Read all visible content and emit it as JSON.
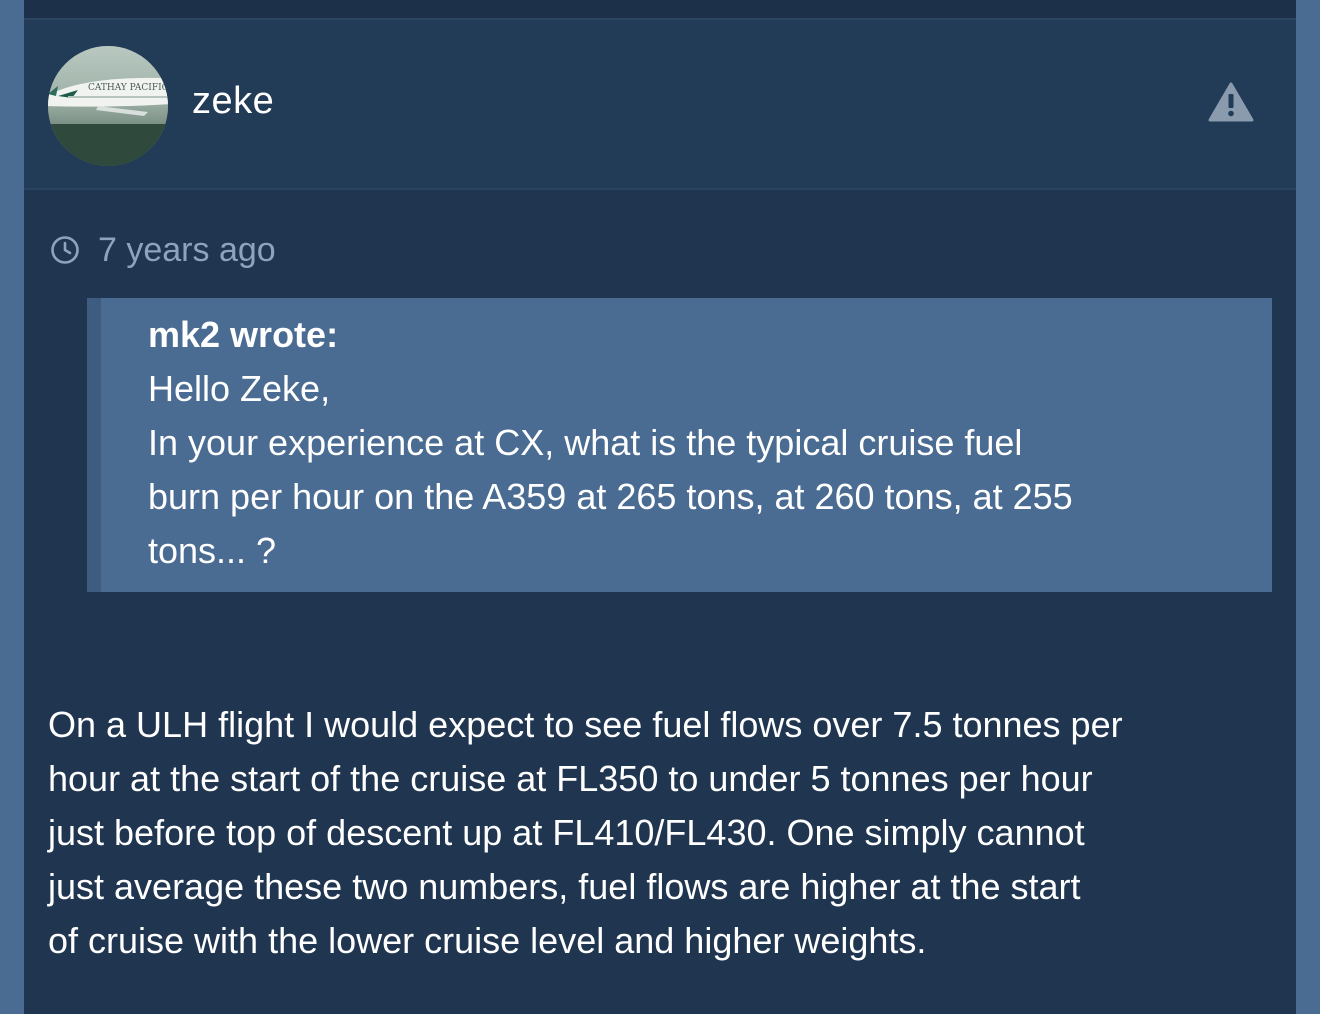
{
  "post": {
    "author": {
      "username": "zeke",
      "avatar_icon": "avatar-airplane-photo",
      "avatar_text": "CATHAY PACIFIC"
    },
    "report_icon": "warning-triangle-icon",
    "timestamp": {
      "icon": "clock-icon",
      "text": "7 years ago"
    },
    "quote": {
      "author_line": "mk2 wrote:",
      "lines": [
        "Hello Zeke,",
        "In your experience at CX, what is the typical cruise fuel",
        "burn per hour on the A359 at 265 tons, at 260 tons, at 255",
        "tons... ?"
      ]
    },
    "body_lines": [
      "On a ULH flight I would expect to see fuel flows over 7.5 tonnes per",
      "hour at the start of the cruise at FL350 to under 5 tonnes per hour",
      "just before top of descent up at FL410/FL430. One simply cannot",
      "just average these two numbers, fuel flows are higher at the start",
      "of cruise with the lower cruise level and higher weights."
    ]
  },
  "colors": {
    "page_background": "#4a6b92",
    "post_background": "#1f3550",
    "header_background": "#223b57",
    "quote_background": "#4a6b92",
    "quote_border": "#3e5c80",
    "timestamp_text": "#8ea4bd",
    "text": "#ffffff"
  }
}
